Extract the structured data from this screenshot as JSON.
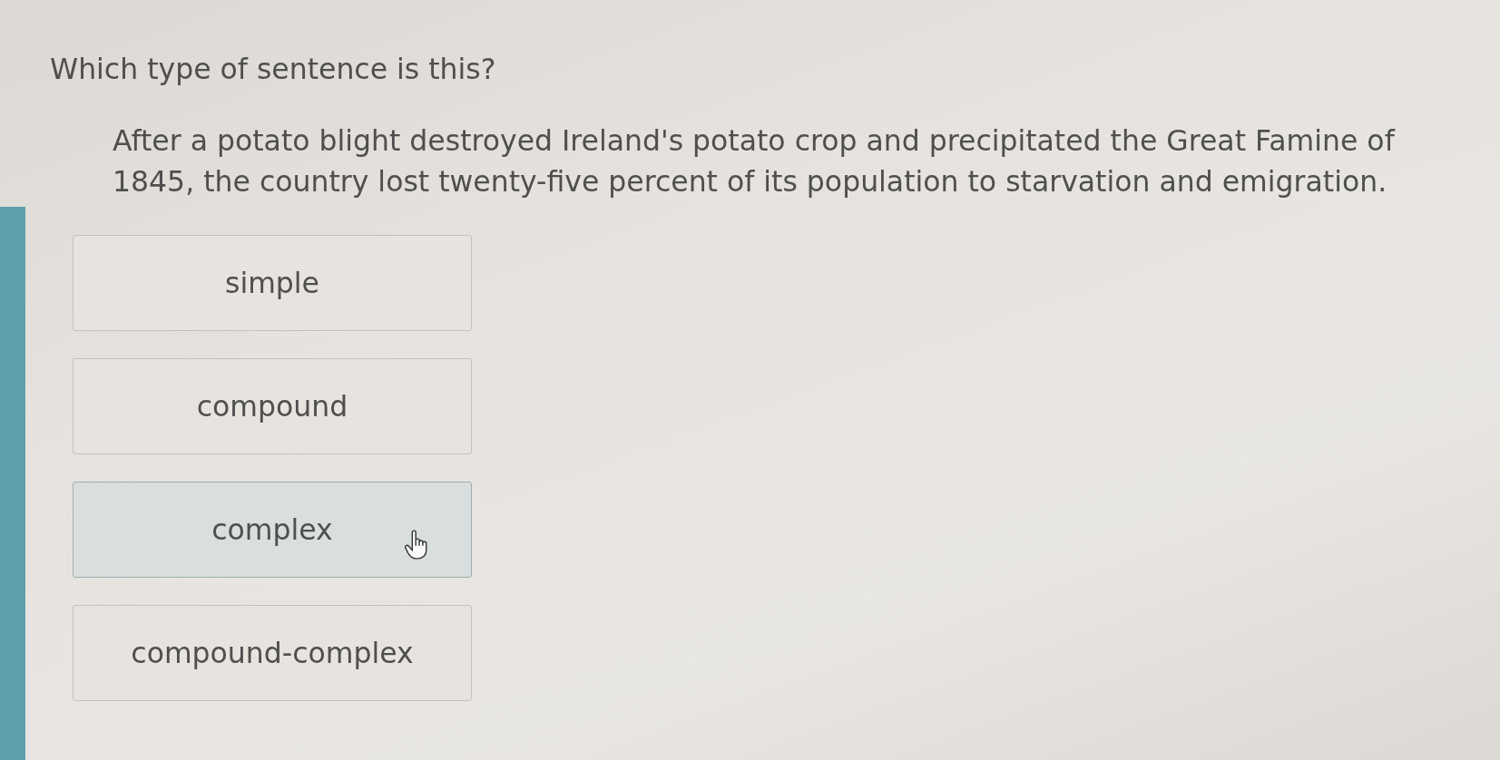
{
  "question": "Which type of sentence is this?",
  "sentence": "After a potato blight destroyed Ireland's potato crop and precipitated the Great Famine of 1845, the country lost twenty-five percent of its population to starvation and emigration.",
  "options": [
    {
      "label": "simple",
      "hovered": false
    },
    {
      "label": "compound",
      "hovered": false
    },
    {
      "label": "complex",
      "hovered": true
    },
    {
      "label": "compound-complex",
      "hovered": false
    }
  ]
}
